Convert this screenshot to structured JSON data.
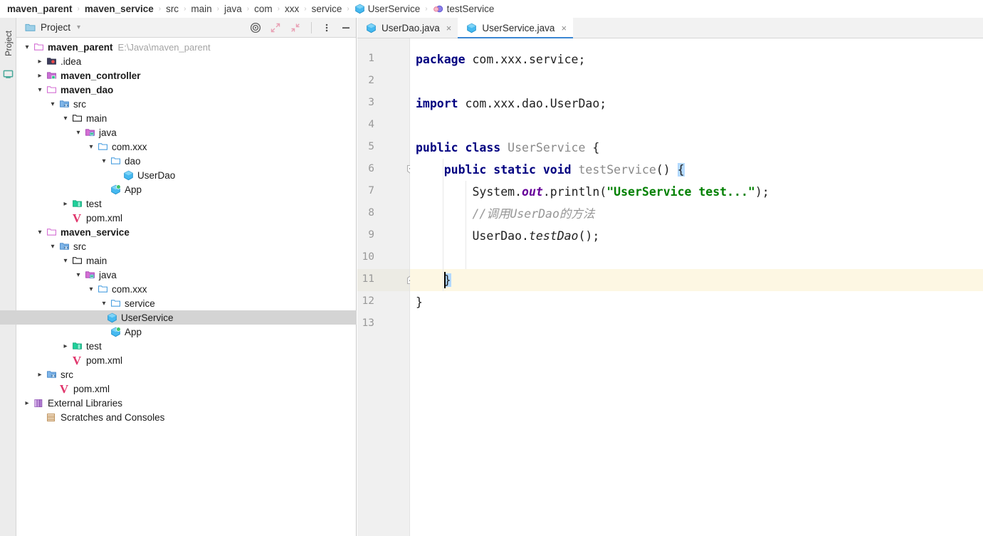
{
  "breadcrumb": {
    "items": [
      {
        "label": "maven_parent",
        "style": "bold",
        "icon": ""
      },
      {
        "label": "maven_service",
        "style": "bold",
        "icon": ""
      },
      {
        "label": "src",
        "style": "normal",
        "icon": ""
      },
      {
        "label": "main",
        "style": "normal",
        "icon": ""
      },
      {
        "label": "java",
        "style": "normal",
        "icon": ""
      },
      {
        "label": "com",
        "style": "normal",
        "icon": ""
      },
      {
        "label": "xxx",
        "style": "normal",
        "icon": ""
      },
      {
        "label": "service",
        "style": "normal",
        "icon": ""
      },
      {
        "label": "UserService",
        "style": "normal",
        "icon": "class-icon"
      },
      {
        "label": "testService",
        "style": "normal",
        "icon": "method-icon"
      }
    ],
    "separator": "›"
  },
  "toolstrip": {
    "project_label": "Project",
    "monitor_icon": "monitor-icon"
  },
  "project_panel": {
    "title": "Project",
    "folder_icon": "folder-icon",
    "dropdown_icon": "chevron-down-icon",
    "tools": [
      {
        "name": "select-opened-file-icon",
        "label": "target-icon"
      },
      {
        "name": "expand-all-icon",
        "label": "expand-arrows-icon"
      },
      {
        "name": "collapse-all-icon",
        "label": "collapse-arrows-icon"
      },
      {
        "name": "more-options-icon",
        "label": "vertical-dots-icon"
      },
      {
        "name": "hide-panel-icon",
        "label": "minus-icon"
      }
    ],
    "tree": [
      {
        "label": "maven_parent",
        "sub": "E:\\Java\\maven_parent",
        "indent": 0,
        "arrow": "down",
        "icon": "module-folder-icon",
        "bold": true,
        "selected": false
      },
      {
        "label": ".idea",
        "sub": "",
        "indent": 1,
        "arrow": "right",
        "icon": "idea-folder-icon",
        "bold": false,
        "selected": false
      },
      {
        "label": "maven_controller",
        "sub": "",
        "indent": 1,
        "arrow": "right",
        "icon": "module-src-folder-icon",
        "bold": true,
        "selected": false
      },
      {
        "label": "maven_dao",
        "sub": "",
        "indent": 1,
        "arrow": "down",
        "icon": "module-folder-icon",
        "bold": true,
        "selected": false
      },
      {
        "label": "src",
        "sub": "",
        "indent": 2,
        "arrow": "down",
        "icon": "src-folder-icon",
        "bold": false,
        "selected": false
      },
      {
        "label": "main",
        "sub": "",
        "indent": 3,
        "arrow": "down",
        "icon": "plain-folder-icon",
        "bold": false,
        "selected": false
      },
      {
        "label": "java",
        "sub": "",
        "indent": 4,
        "arrow": "down",
        "icon": "sources-root-folder-icon",
        "bold": false,
        "selected": false
      },
      {
        "label": "com.xxx",
        "sub": "",
        "indent": 5,
        "arrow": "down",
        "icon": "package-folder-icon",
        "bold": false,
        "selected": false
      },
      {
        "label": "dao",
        "sub": "",
        "indent": 6,
        "arrow": "down",
        "icon": "package-folder-icon",
        "bold": false,
        "selected": false
      },
      {
        "label": "UserDao",
        "sub": "",
        "indent": 7,
        "arrow": "none",
        "icon": "java-class-icon",
        "bold": false,
        "selected": false
      },
      {
        "label": "App",
        "sub": "",
        "indent": 6,
        "arrow": "none",
        "icon": "java-runnable-class-icon",
        "bold": false,
        "selected": false
      },
      {
        "label": "test",
        "sub": "",
        "indent": 3,
        "arrow": "right",
        "icon": "test-folder-icon",
        "bold": false,
        "selected": false
      },
      {
        "label": "pom.xml",
        "sub": "",
        "indent": 3,
        "arrow": "none",
        "icon": "maven-pom-icon",
        "bold": false,
        "selected": false
      },
      {
        "label": "maven_service",
        "sub": "",
        "indent": 1,
        "arrow": "down",
        "icon": "module-folder-icon",
        "bold": true,
        "selected": false
      },
      {
        "label": "src",
        "sub": "",
        "indent": 2,
        "arrow": "down",
        "icon": "src-folder-icon",
        "bold": false,
        "selected": false
      },
      {
        "label": "main",
        "sub": "",
        "indent": 3,
        "arrow": "down",
        "icon": "plain-folder-icon",
        "bold": false,
        "selected": false
      },
      {
        "label": "java",
        "sub": "",
        "indent": 4,
        "arrow": "down",
        "icon": "sources-root-folder-icon",
        "bold": false,
        "selected": false
      },
      {
        "label": "com.xxx",
        "sub": "",
        "indent": 5,
        "arrow": "down",
        "icon": "package-folder-icon",
        "bold": false,
        "selected": false
      },
      {
        "label": "service",
        "sub": "",
        "indent": 6,
        "arrow": "down",
        "icon": "package-folder-icon",
        "bold": false,
        "selected": false
      },
      {
        "label": "UserService",
        "sub": "",
        "indent": 7,
        "arrow": "none",
        "icon": "java-class-icon",
        "bold": false,
        "selected": true
      },
      {
        "label": "App",
        "sub": "",
        "indent": 6,
        "arrow": "none",
        "icon": "java-runnable-class-icon",
        "bold": false,
        "selected": false
      },
      {
        "label": "test",
        "sub": "",
        "indent": 3,
        "arrow": "right",
        "icon": "test-folder-icon",
        "bold": false,
        "selected": false
      },
      {
        "label": "pom.xml",
        "sub": "",
        "indent": 3,
        "arrow": "none",
        "icon": "maven-pom-icon",
        "bold": false,
        "selected": false
      },
      {
        "label": "src",
        "sub": "",
        "indent": 1,
        "arrow": "right",
        "icon": "src-folder-icon",
        "bold": false,
        "selected": false
      },
      {
        "label": "pom.xml",
        "sub": "",
        "indent": 2,
        "arrow": "none",
        "icon": "maven-pom-icon",
        "bold": false,
        "selected": false
      },
      {
        "label": "External Libraries",
        "sub": "",
        "indent": 0,
        "arrow": "right",
        "icon": "libraries-icon",
        "bold": false,
        "selected": false
      },
      {
        "label": "Scratches and Consoles",
        "sub": "",
        "indent": 1,
        "arrow": "none",
        "icon": "scratches-icon",
        "bold": false,
        "selected": false
      }
    ]
  },
  "editor": {
    "tabs": [
      {
        "label": "UserDao.java",
        "icon": "java-class-icon",
        "active": false,
        "close": "×"
      },
      {
        "label": "UserService.java",
        "icon": "java-class-icon",
        "active": true,
        "close": "×"
      }
    ],
    "line_numbers": [
      "1",
      "2",
      "3",
      "4",
      "5",
      "6",
      "7",
      "8",
      "9",
      "10",
      "11",
      "12",
      "13"
    ],
    "caret_line": 11,
    "fold_start_line": 6,
    "fold_end_line": 11,
    "code_lines": [
      {
        "n": 1,
        "tokens": [
          {
            "t": "package",
            "c": "kw"
          },
          {
            "t": " com.xxx.service;",
            "c": "pln"
          }
        ]
      },
      {
        "n": 2,
        "tokens": []
      },
      {
        "n": 3,
        "tokens": [
          {
            "t": "import",
            "c": "kw"
          },
          {
            "t": " com.xxx.dao.UserDao;",
            "c": "pln"
          }
        ]
      },
      {
        "n": 4,
        "tokens": []
      },
      {
        "n": 5,
        "tokens": [
          {
            "t": "public class",
            "c": "kw"
          },
          {
            "t": " ",
            "c": "pln"
          },
          {
            "t": "UserService",
            "c": "cls"
          },
          {
            "t": " {",
            "c": "pln"
          }
        ]
      },
      {
        "n": 6,
        "tokens": [
          {
            "t": "    ",
            "c": "pln"
          },
          {
            "t": "public static void",
            "c": "kw"
          },
          {
            "t": " ",
            "c": "pln"
          },
          {
            "t": "testService",
            "c": "cls"
          },
          {
            "t": "() ",
            "c": "pln"
          },
          {
            "t": "{",
            "c": "pln brace-hl"
          }
        ]
      },
      {
        "n": 7,
        "tokens": [
          {
            "t": "        System.",
            "c": "pln"
          },
          {
            "t": "out",
            "c": "fld"
          },
          {
            "t": ".println(",
            "c": "pln"
          },
          {
            "t": "\"UserService test...\"",
            "c": "str"
          },
          {
            "t": ");",
            "c": "pln"
          }
        ]
      },
      {
        "n": 8,
        "tokens": [
          {
            "t": "        ",
            "c": "pln"
          },
          {
            "t": "//调用UserDao的方法",
            "c": "cmt"
          }
        ]
      },
      {
        "n": 9,
        "tokens": [
          {
            "t": "        UserDao.",
            "c": "pln"
          },
          {
            "t": "testDao",
            "c": "mth"
          },
          {
            "t": "();",
            "c": "pln"
          }
        ]
      },
      {
        "n": 10,
        "tokens": []
      },
      {
        "n": 11,
        "tokens": [
          {
            "t": "    ",
            "c": "pln"
          },
          {
            "t": "}",
            "c": "pln brace-hl"
          }
        ]
      },
      {
        "n": 12,
        "tokens": [
          {
            "t": "}",
            "c": "pln"
          }
        ]
      },
      {
        "n": 13,
        "tokens": []
      }
    ]
  },
  "colors": {
    "keyword": "#000080",
    "string": "#008000",
    "comment": "#969696",
    "class_name": "#8a8a8a",
    "static_field": "#660099",
    "brace_highlight": "#b3d9ff",
    "caret_line": "#fdf7e3",
    "selection": "#d4d4d4",
    "tab_accent": "#3b87d3"
  }
}
